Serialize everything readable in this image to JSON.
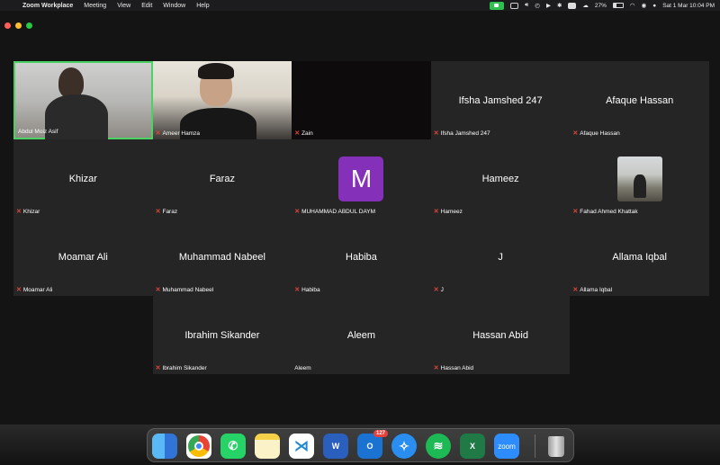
{
  "menubar": {
    "app_name": "Zoom Workplace",
    "menus": [
      "Meeting",
      "View",
      "Edit",
      "Window",
      "Help"
    ],
    "battery": "27%",
    "datetime": "Sat 1 Mar  10:04 PM"
  },
  "tiles": [
    {
      "name": "Abdul Moiz Asif",
      "label": "Abdul Moiz Asif",
      "muted": false,
      "kind": "video"
    },
    {
      "name": "Ameer Hamza",
      "label": "Ameer Hamza",
      "muted": true,
      "kind": "video"
    },
    {
      "name": "Zain",
      "label": "Zain",
      "muted": true,
      "kind": "blank"
    },
    {
      "name": "Ifsha Jamshed 247",
      "label": "Ifsha Jamshed 247",
      "muted": true,
      "kind": "name"
    },
    {
      "name": "Afaque Hassan",
      "label": "Afaque Hassan",
      "muted": true,
      "kind": "name"
    },
    {
      "name": "Khizar",
      "label": "Khizar",
      "muted": true,
      "kind": "name"
    },
    {
      "name": "Faraz",
      "label": "Faraz",
      "muted": true,
      "kind": "name"
    },
    {
      "name": "M",
      "label": "MUHAMMAD ABDUL DAYM",
      "muted": true,
      "kind": "avatar"
    },
    {
      "name": "Hameez",
      "label": "Hameez",
      "muted": true,
      "kind": "name"
    },
    {
      "name": "",
      "label": "Fahad Ahmed Khattak",
      "muted": true,
      "kind": "photo"
    },
    {
      "name": "Moamar Ali",
      "label": "Moamar Ali",
      "muted": true,
      "kind": "name"
    },
    {
      "name": "Muhammad Nabeel",
      "label": "Muhammad Nabeel",
      "muted": true,
      "kind": "name"
    },
    {
      "name": "Habiba",
      "label": "Habiba",
      "muted": true,
      "kind": "name"
    },
    {
      "name": "J",
      "label": "J",
      "muted": true,
      "kind": "name"
    },
    {
      "name": "Allama Iqbal",
      "label": "Allama Iqbal",
      "muted": true,
      "kind": "name"
    },
    {
      "name": "Ibrahim Sikander",
      "label": "Ibrahim Sikander",
      "muted": true,
      "kind": "name"
    },
    {
      "name": "Aleem",
      "label": "Aleem",
      "muted": false,
      "kind": "name"
    },
    {
      "name": "Hassan Abid",
      "label": "Hassan Abid",
      "muted": true,
      "kind": "name"
    }
  ],
  "dock": {
    "apps": [
      "finder-icon",
      "chrome-icon",
      "whatsapp-icon",
      "notes-icon",
      "vscode-icon",
      "word-icon",
      "outlook-icon",
      "safari-icon",
      "spotify-icon",
      "excel-icon",
      "zoom-icon",
      "trash-icon"
    ],
    "outlook_badge": "127",
    "zoom_label": "zoom"
  },
  "colors": {
    "active_border": "#4ad263",
    "tile_bg": "#252525",
    "mute_red": "#e0463b",
    "avatar_purple": "#8530b8"
  }
}
